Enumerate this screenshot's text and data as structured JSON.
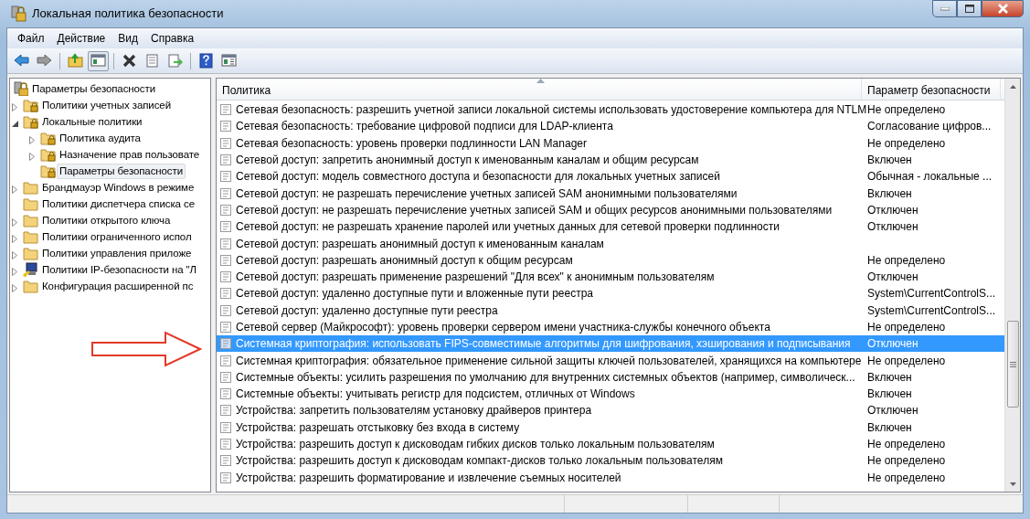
{
  "window": {
    "title": "Локальная политика безопасности"
  },
  "menu": [
    "Файл",
    "Действие",
    "Вид",
    "Справка"
  ],
  "toolbar": [
    {
      "pressed": false
    },
    {
      "pressed": false
    },
    {
      "pressed": false
    },
    {
      "pressed": true
    },
    {
      "pressed": false
    },
    {
      "pressed": false
    },
    {
      "pressed": false
    },
    {
      "pressed": false
    },
    {
      "pressed": false
    }
  ],
  "tree": [
    {
      "label": "Параметры безопасности",
      "kind": "root",
      "selected": false,
      "children": [
        {
          "label": "Политики учетных записей",
          "kind": "secure",
          "expanded": false,
          "selected": false
        },
        {
          "label": "Локальные политики",
          "kind": "secure",
          "expanded": true,
          "selected": false,
          "children": [
            {
              "label": "Политика аудита",
              "kind": "secure",
              "expanded": false,
              "selected": false
            },
            {
              "label": "Назначение прав пользовате",
              "kind": "secure",
              "expanded": false,
              "selected": false
            },
            {
              "label": "Параметры безопасности",
              "kind": "secure",
              "selected": true
            }
          ]
        },
        {
          "label": "Брандмауэр Windows в режиме",
          "kind": "plain",
          "expanded": false,
          "selected": false
        },
        {
          "label": "Политики диспетчера списка се",
          "kind": "plain",
          "selected": false
        },
        {
          "label": "Политики открытого ключа",
          "kind": "plain",
          "expanded": false,
          "selected": false
        },
        {
          "label": "Политики ограниченного испол",
          "kind": "plain",
          "expanded": false,
          "selected": false
        },
        {
          "label": "Политики управления приложе",
          "kind": "plain",
          "expanded": false,
          "selected": false
        },
        {
          "label": "Политики IP-безопасности на \"Л",
          "kind": "ip",
          "expanded": false,
          "selected": false
        },
        {
          "label": "Конфигурация расширенной пс",
          "kind": "plain",
          "expanded": false,
          "selected": false
        }
      ]
    }
  ],
  "table": {
    "columns": [
      "Политика",
      "Параметр безопасности"
    ],
    "rows": [
      {
        "policy": "Сетевая безопасность: разрешить учетной записи локальной системы использовать удостоверение компьютера для NTLM",
        "setting": "Не определено",
        "selected": false
      },
      {
        "policy": "Сетевая безопасность: требование цифровой подписи для LDAP-клиента",
        "setting": "Согласование цифров...",
        "selected": false
      },
      {
        "policy": "Сетевая безопасность: уровень проверки подлинности LAN Manager",
        "setting": "Не определено",
        "selected": false
      },
      {
        "policy": "Сетевой доступ: запретить анонимный доступ к именованным каналам и общим ресурсам",
        "setting": "Включен",
        "selected": false
      },
      {
        "policy": "Сетевой доступ: модель совместного доступа и безопасности для локальных учетных записей",
        "setting": "Обычная - локальные ...",
        "selected": false
      },
      {
        "policy": "Сетевой доступ: не разрешать перечисление учетных записей SAM анонимными пользователями",
        "setting": "Включен",
        "selected": false
      },
      {
        "policy": "Сетевой доступ: не разрешать перечисление учетных записей SAM и общих ресурсов анонимными пользователями",
        "setting": "Отключен",
        "selected": false
      },
      {
        "policy": "Сетевой доступ: не разрешать хранение паролей или учетных данных для сетевой проверки подлинности",
        "setting": "Отключен",
        "selected": false
      },
      {
        "policy": "Сетевой доступ: разрешать анонимный доступ к именованным каналам",
        "selected": false
      },
      {
        "policy": "Сетевой доступ: разрешать анонимный доступ к общим ресурсам",
        "setting": "Не определено",
        "selected": false
      },
      {
        "policy": "Сетевой доступ: разрешать применение разрешений \"Для всех\" к анонимным пользователям",
        "setting": "Отключен",
        "selected": false
      },
      {
        "policy": "Сетевой доступ: удаленно доступные пути и вложенные пути реестра",
        "setting": "System\\CurrentControlS...",
        "selected": false
      },
      {
        "policy": "Сетевой доступ: удаленно доступные пути реестра",
        "setting": "System\\CurrentControlS...",
        "selected": false
      },
      {
        "policy": "Сетевой сервер (Майкрософт): уровень проверки сервером имени участника-службы конечного объекта",
        "setting": "Не определено",
        "selected": false
      },
      {
        "policy": "Системная криптография: использовать FIPS-совместимые алгоритмы для шифрования, хэширования и подписывания",
        "setting": "Отключен",
        "selected": true
      },
      {
        "policy": "Системная криптография: обязательное применение сильной защиты ключей пользователей, хранящихся на компьютере",
        "setting": "Не определено",
        "selected": false
      },
      {
        "policy": "Системные объекты: усилить разрешения по умолчанию для внутренних системных объектов (например, символическ...",
        "setting": "Включен",
        "selected": false
      },
      {
        "policy": "Системные объекты: учитывать регистр для подсистем, отличных от Windows",
        "setting": "Включен",
        "selected": false
      },
      {
        "policy": "Устройства: запретить пользователям установку драйверов принтера",
        "setting": "Отключен",
        "selected": false
      },
      {
        "policy": "Устройства: разрешать отстыковку без входа в систему",
        "setting": "Включен",
        "selected": false
      },
      {
        "policy": "Устройства: разрешить доступ к дисководам гибких дисков только локальным пользователям",
        "setting": "Не определено",
        "selected": false
      },
      {
        "policy": "Устройства: разрешить доступ к дисководам компакт-дисков только локальным пользователям",
        "setting": "Не определено",
        "selected": false
      },
      {
        "policy": "Устройства: разрешить форматирование и извлечение съемных носителей",
        "setting": "Не определено",
        "selected": false
      }
    ]
  }
}
